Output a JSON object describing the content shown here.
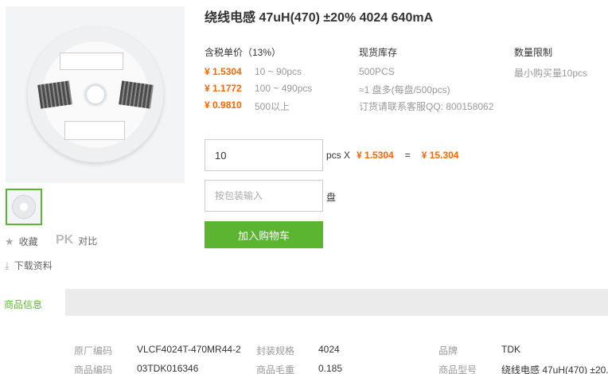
{
  "product": {
    "title": "绕线电感 47uH(470) ±20% 4024 640mA"
  },
  "gallery": {
    "fav_label": "收藏",
    "pk_icon_text": "PK",
    "compare_label": "对比",
    "download_label": "下载资料"
  },
  "pricing": {
    "header": "含税单价（13%）",
    "tiers": [
      {
        "price": "¥ 1.5304",
        "range": "10 ~ 90pcs"
      },
      {
        "price": "¥ 1.1772",
        "range": "100 ~ 490pcs"
      },
      {
        "price": "¥ 0.9810",
        "range": "500以上"
      }
    ]
  },
  "stock": {
    "header": "现货库存",
    "lines": [
      "500PCS",
      "≈1 盘多(每盘/500pcs)",
      "订货请联系客服QQ: 800158062"
    ]
  },
  "limit": {
    "header": "数量限制",
    "text": "最小购买量10pcs"
  },
  "order": {
    "qty_value": "10",
    "unit_label": "pcs X",
    "unit_price": "¥ 1.5304",
    "equals": "=",
    "total": "¥ 15.304",
    "pack_placeholder": "按包装输入",
    "pack_unit": "盘",
    "add_cart_label": "加入购物车"
  },
  "tabs": {
    "active": "商品信息"
  },
  "specs": [
    {
      "k1": "原厂编码",
      "v1": "VLCF4024T-470MR44-2",
      "k2": "封装规格",
      "v2": "4024",
      "k3": "品牌",
      "v3": "TDK"
    },
    {
      "k1": "商品编码",
      "v1": "03TDK016346",
      "k2": "商品毛重",
      "v2": "0.185",
      "k3": "商品型号",
      "v3": "绕线电感 47uH(470) ±20."
    }
  ],
  "colors": {
    "accent_green": "#5cb531",
    "price_orange": "#ff6600"
  }
}
